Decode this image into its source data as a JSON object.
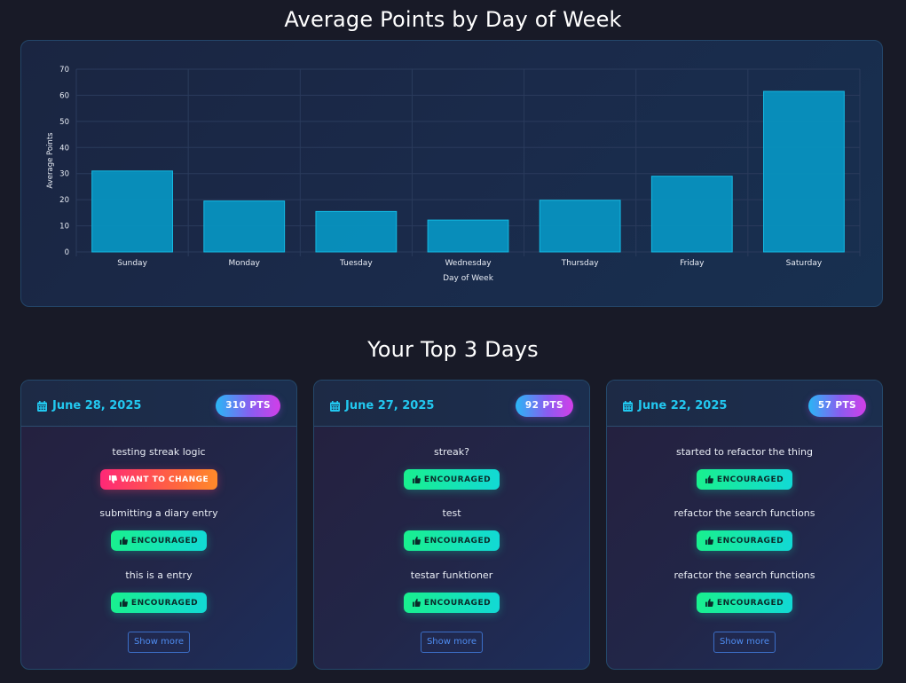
{
  "chart_data": {
    "type": "bar",
    "title": "Average Points by Day of Week",
    "xlabel": "Day of Week",
    "ylabel": "Average Points",
    "categories": [
      "Sunday",
      "Monday",
      "Tuesday",
      "Wednesday",
      "Thursday",
      "Friday",
      "Saturday"
    ],
    "values": [
      31,
      19.5,
      15.5,
      12.2,
      19.8,
      29,
      61.5
    ],
    "ylim": [
      0,
      70
    ],
    "yticks": [
      0,
      10,
      20,
      30,
      40,
      50,
      60,
      70
    ],
    "grid": true,
    "legend": "none",
    "colors": {
      "bar_fill": "#0893c0",
      "bar_stroke": "#14c2ec",
      "grid": "#2a3b5c",
      "tick_text": "#e8ecf4"
    }
  },
  "top_days": {
    "title": "Your Top 3 Days",
    "show_more_label": "Show more",
    "cards": [
      {
        "date": "June 28, 2025",
        "points": "310 PTS",
        "entries": [
          {
            "text": "testing streak logic",
            "tag": "WANT TO CHANGE",
            "tag_type": "change",
            "tag_icon": "thumbs-down-icon"
          },
          {
            "text": "submitting a diary entry",
            "tag": "ENCOURAGED",
            "tag_type": "encouraged",
            "tag_icon": "thumbs-up-icon"
          },
          {
            "text": "this is a entry",
            "tag": "ENCOURAGED",
            "tag_type": "encouraged",
            "tag_icon": "thumbs-up-icon"
          }
        ]
      },
      {
        "date": "June 27, 2025",
        "points": "92 PTS",
        "entries": [
          {
            "text": "streak?",
            "tag": "ENCOURAGED",
            "tag_type": "encouraged",
            "tag_icon": "thumbs-up-icon"
          },
          {
            "text": "test",
            "tag": "ENCOURAGED",
            "tag_type": "encouraged",
            "tag_icon": "thumbs-up-icon"
          },
          {
            "text": "testar funktioner",
            "tag": "ENCOURAGED",
            "tag_type": "encouraged",
            "tag_icon": "thumbs-up-icon"
          }
        ]
      },
      {
        "date": "June 22, 2025",
        "points": "57 PTS",
        "entries": [
          {
            "text": "started to refactor the thing",
            "tag": "ENCOURAGED",
            "tag_type": "encouraged",
            "tag_icon": "thumbs-up-icon"
          },
          {
            "text": "refactor the search functions",
            "tag": "ENCOURAGED",
            "tag_type": "encouraged",
            "tag_icon": "thumbs-up-icon"
          },
          {
            "text": "refactor the search functions",
            "tag": "ENCOURAGED",
            "tag_type": "encouraged",
            "tag_icon": "thumbs-up-icon"
          }
        ]
      }
    ]
  }
}
